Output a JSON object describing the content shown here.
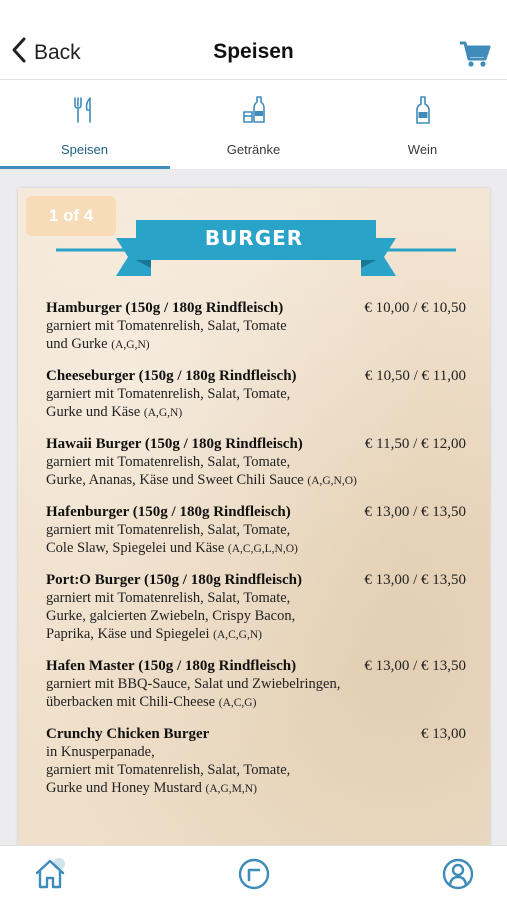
{
  "header": {
    "back_label": "Back",
    "title": "Speisen",
    "cart_icon": "cart-icon",
    "accent_color": "#3f8cba"
  },
  "tabs": [
    {
      "label": "Speisen",
      "icon": "cutlery-icon",
      "active": true
    },
    {
      "label": "Getränke",
      "icon": "drinks-icon",
      "active": false
    },
    {
      "label": "Wein",
      "icon": "wine-bottle-icon",
      "active": false
    }
  ],
  "menu": {
    "page_indicator": "1 of 4",
    "section_title": "BURGER",
    "banner_color": "#2aa3c9",
    "items": [
      {
        "name": "Hamburger (150g / 180g Rindfleisch)",
        "price": "€ 10,00 / € 10,50",
        "lines": [
          "garniert mit Tomatenrelish, Salat, Tomate",
          "und Gurke"
        ],
        "allergens": "(A,G,N)"
      },
      {
        "name": "Cheeseburger (150g / 180g Rindfleisch)",
        "price": "€ 10,50 / € 11,00",
        "lines": [
          "garniert mit Tomatenrelish, Salat, Tomate,",
          "Gurke und Käse"
        ],
        "allergens": "(A,G,N)"
      },
      {
        "name": "Hawaii Burger (150g / 180g Rindfleisch)",
        "price": "€ 11,50 / € 12,00",
        "lines": [
          "garniert mit Tomatenrelish, Salat, Tomate,",
          "Gurke, Ananas, Käse und Sweet Chili Sauce"
        ],
        "allergens": "(A,G,N,O)"
      },
      {
        "name": "Hafenburger (150g / 180g Rindfleisch)",
        "price": "€ 13,00 / € 13,50",
        "lines": [
          "garniert mit Tomatenrelish, Salat, Tomate,",
          "Cole Slaw, Spiegelei und Käse"
        ],
        "allergens": "(A,C,G,L,N,O)"
      },
      {
        "name": "Port:O Burger (150g / 180g Rindfleisch)",
        "price": "€ 13,00 / € 13,50",
        "lines": [
          "garniert mit Tomatenrelish, Salat, Tomate,",
          "Gurke, galcierten Zwiebeln, Crispy Bacon,",
          "Paprika, Käse und Spiegelei"
        ],
        "allergens": "(A,C,G,N)"
      },
      {
        "name": "Hafen Master (150g / 180g Rindfleisch)",
        "price": "€ 13,00 / € 13,50",
        "lines": [
          "garniert mit BBQ-Sauce, Salat und Zwiebelringen,",
          "überbacken mit Chili-Cheese"
        ],
        "allergens": "(A,C,G)"
      },
      {
        "name": "Crunchy Chicken Burger",
        "price": "€ 13,00",
        "lines": [
          "in Knusperpanade,",
          "garniert mit Tomatenrelish, Salat, Tomate,",
          "Gurke und Honey Mustard"
        ],
        "allergens": "(A,G,M,N)"
      }
    ]
  },
  "bottom_nav": [
    {
      "icon": "home-icon"
    },
    {
      "icon": "clock-icon"
    },
    {
      "icon": "profile-icon"
    }
  ]
}
